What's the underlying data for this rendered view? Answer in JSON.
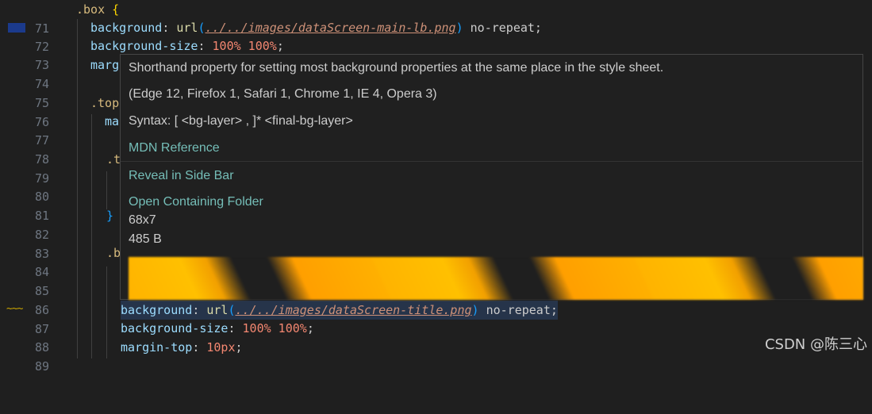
{
  "editor": {
    "lines": [
      {
        "n": "71"
      },
      {
        "n": "72"
      },
      {
        "n": "73"
      },
      {
        "n": "74"
      },
      {
        "n": "75"
      },
      {
        "n": "76"
      },
      {
        "n": "77"
      },
      {
        "n": "78"
      },
      {
        "n": "79"
      },
      {
        "n": "80"
      },
      {
        "n": "81"
      },
      {
        "n": "82"
      },
      {
        "n": "83"
      },
      {
        "n": "84"
      },
      {
        "n": "85"
      },
      {
        "n": "86"
      },
      {
        "n": "87"
      },
      {
        "n": "88"
      },
      {
        "n": "89"
      }
    ],
    "l71": {
      "sel": ".box",
      "brace": "{"
    },
    "l72": {
      "prop": "background",
      "colon": ": ",
      "fn": "url",
      "open": "(",
      "url": "../../images/dataScreen-main-lb.png",
      "close": ")",
      "rest": " no-repeat;"
    },
    "l73": {
      "prop": "background-size",
      "colon": ": ",
      "num": "100% 100%",
      "semi": ";"
    },
    "l74": {
      "prop": "marg"
    },
    "l76": {
      "sel": ".top"
    },
    "l77": {
      "prop": "ma"
    },
    "l79": {
      "sel": ".t"
    },
    "l82": {
      "brace": "}"
    },
    "l84": {
      "sel": ".b"
    },
    "l87": {
      "prop": "background",
      "colon": ": ",
      "fn": "url",
      "open": "(",
      "url": "../../images/dataScreen-title.png",
      "close": ")",
      "rest": " no-repeat;"
    },
    "l88": {
      "prop": "background-size",
      "colon": ": ",
      "num": "100% 100%",
      "semi": ";"
    },
    "l89": {
      "prop": "margin-top",
      "colon": ": ",
      "num": "10px",
      "semi": ";"
    }
  },
  "hover": {
    "description": "Shorthand property for setting most background properties at the same place in the style sheet.",
    "compat": "(Edge 12, Firefox 1, Safari 1, Chrome 1, IE 4, Opera 3)",
    "syntax": "Syntax: [ <bg-layer> , ]* <final-bg-layer>",
    "mdn_link": "MDN Reference",
    "reveal_link": "Reveal in Side Bar",
    "folder_link": "Open Containing Folder",
    "dimensions": "68x7",
    "size": "485 B"
  },
  "gutter": {
    "warn_glyph": "~~~"
  },
  "watermark": "CSDN @陈三心"
}
